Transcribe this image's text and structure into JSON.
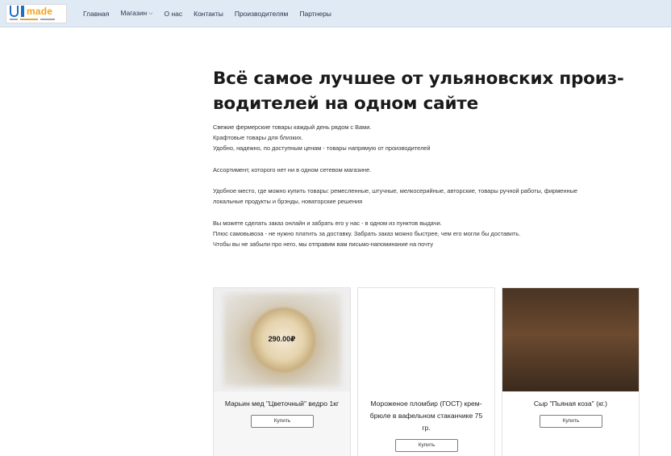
{
  "logo": {
    "text": "made"
  },
  "nav": {
    "items": [
      {
        "label": "Главная"
      },
      {
        "label": "Магазин",
        "has_dropdown": true
      },
      {
        "label": "О нас"
      },
      {
        "label": "Контакты"
      },
      {
        "label": "Производителям"
      },
      {
        "label": "Партнеры"
      }
    ]
  },
  "hero": {
    "title_line1": "Всё самое лучшее от ульяновских произ-",
    "title_line2": "водителей на одном сайте",
    "paragraph1": [
      "Свежие фермерские товары каждый день рядом с Вами.",
      "Крафтовые товары для близких.",
      "Удобно, надежно, по доступным ценам - товары напрямую от производителей"
    ],
    "paragraph2": "Ассортимент, которого  нет ни в одном сетевом магазине.",
    "paragraph3": [
      "Удобное место, где можно купить товары: ремесленные, штучные, мелкосерийные, авторские, товары ручной работы, фирменные",
      "локальные продукты и брэнды, новаторские решения"
    ],
    "paragraph4": [
      "Вы можете сделать заказ онлайн и забрать его у нас - в одном из пунктов выдачи.",
      "Плюс самовывоза - не нужно платить за доставку. Забрать заказ можно быстрее, чем его могли бы доставить.",
      "Чтобы вы не забыли про него, мы отправим вам письмо-напоминание на почту"
    ]
  },
  "products": [
    {
      "name": "Марьин мед \"Цветочный\" ведро 1кг",
      "price": "290.00₽",
      "button": "Купить",
      "image": "honey-bucket-blurred"
    },
    {
      "name_lines": [
        "Мороженое пломбир (ГОСТ) крем-",
        "брюле в вафельном стаканчике 75",
        "гр."
      ],
      "button": "Купить",
      "image": "ice-cream-pack"
    },
    {
      "name": "Сыр \"Пьяная коза\" (кг.)",
      "button": "Купить",
      "image": "cheese-wheel-photo"
    }
  ],
  "colors": {
    "navbar_bg": "#dfeaf5",
    "logo_blue": "#1c6fc4",
    "logo_orange": "#f4a21c"
  }
}
